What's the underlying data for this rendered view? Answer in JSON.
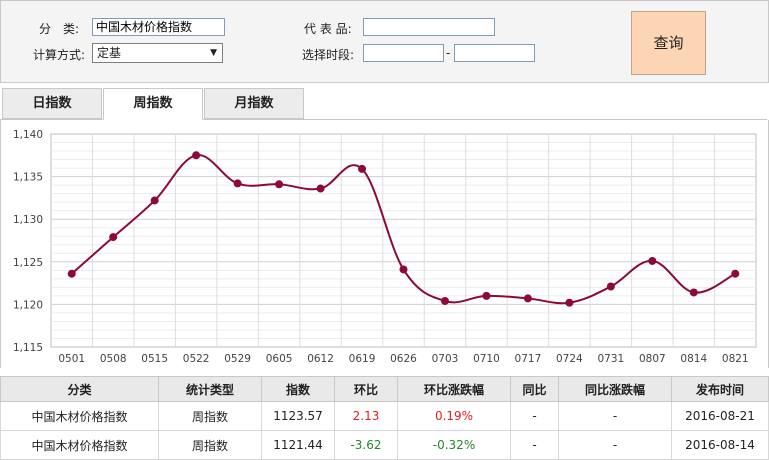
{
  "query": {
    "category_label": "分　类:",
    "category_value": "中国木材价格指数",
    "method_label": "计算方式:",
    "method_value": "定基",
    "code_label": "代 表 品:",
    "code_value": "",
    "period_label": "选择时段:",
    "period_start": "",
    "period_end": "",
    "dash": "-",
    "search_button": "查询"
  },
  "tabs": [
    {
      "label": "日指数",
      "active": false
    },
    {
      "label": "周指数",
      "active": true
    },
    {
      "label": "月指数",
      "active": false
    }
  ],
  "colors": {
    "line": "#8b0a3a",
    "grid": "#d8d8d8",
    "accent_tab_bg": "#fcd5b4"
  },
  "chart_data": {
    "type": "line",
    "categories": [
      "0501",
      "0508",
      "0515",
      "0522",
      "0529",
      "0605",
      "0612",
      "0619",
      "0626",
      "0703",
      "0710",
      "0717",
      "0724",
      "0731",
      "0807",
      "0814",
      "0821"
    ],
    "series": [
      {
        "values": [
          1123.6,
          1127.9,
          1132.2,
          1137.5,
          1134.2,
          1134.1,
          1133.6,
          1135.9,
          1124.1,
          1120.4,
          1121.0,
          1120.7,
          1120.2,
          1122.1,
          1125.1,
          1121.4,
          1123.6
        ]
      }
    ],
    "ylim": [
      1115,
      1140
    ],
    "yticks": [
      1115,
      1120,
      1125,
      1130,
      1135,
      1140
    ],
    "ytick_labels": [
      "1,115",
      "1,120",
      "1,125",
      "1,130",
      "1,135",
      "1,140"
    ],
    "grid": true
  },
  "table": {
    "headers": [
      "分类",
      "统计类型",
      "指数",
      "环比",
      "环比涨跌幅",
      "同比",
      "同比涨跌幅",
      "发布时间"
    ],
    "rows": [
      {
        "cells": [
          "中国木材价格指数",
          "周指数",
          "1123.57",
          "2.13",
          "0.19%",
          "-",
          "-",
          "2016-08-21"
        ],
        "trend": "up"
      },
      {
        "cells": [
          "中国木材价格指数",
          "周指数",
          "1121.44",
          "-3.62",
          "-0.32%",
          "-",
          "-",
          "2016-08-14"
        ],
        "trend": "down"
      }
    ]
  }
}
